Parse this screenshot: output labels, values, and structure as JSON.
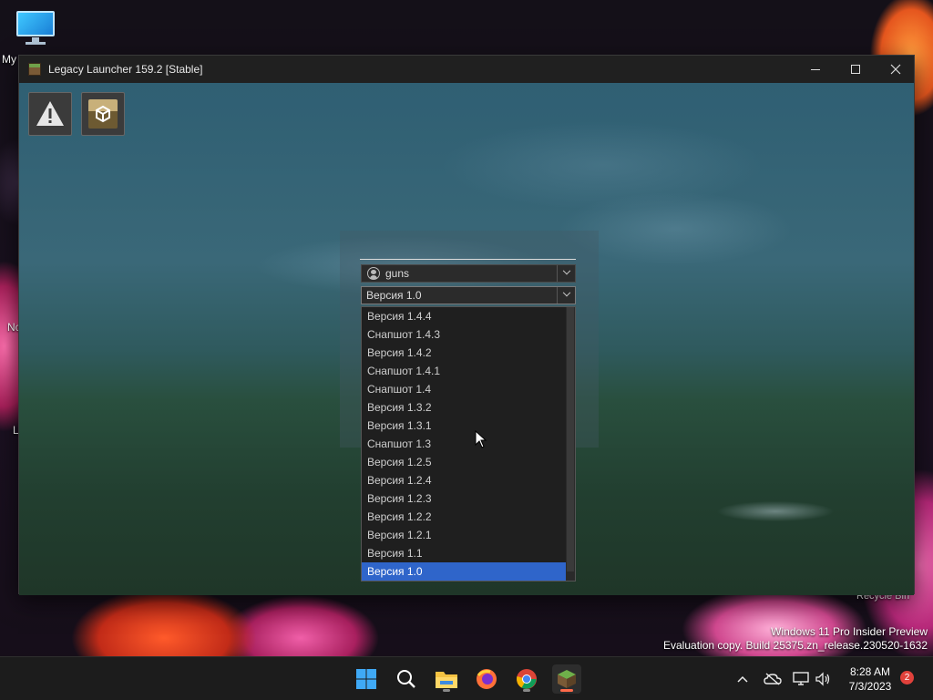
{
  "desktop": {
    "icons": [
      {
        "label": "My"
      },
      {
        "label": "Nc"
      },
      {
        "label": "L"
      }
    ],
    "recycle_bin_label": "Recycle Bin",
    "watermark_line1": "Windows 11 Pro Insider Preview",
    "watermark_line2": "Evaluation copy. Build 25375.zn_release.230520-1632"
  },
  "window": {
    "title": "Legacy Launcher 159.2 [Stable]",
    "buttons": {
      "minimize": "minimize",
      "maximize": "maximize",
      "close": "close"
    }
  },
  "launcher": {
    "account": {
      "username": "guns"
    },
    "version_selector": {
      "selected": "Версия 1.0",
      "options": [
        "Версия 1.4.4",
        "Снапшот 1.4.3",
        "Версия 1.4.2",
        "Снапшот 1.4.1",
        "Снапшот 1.4",
        "Версия 1.3.2",
        "Версия 1.3.1",
        "Снапшот 1.3",
        "Версия 1.2.5",
        "Версия 1.2.4",
        "Версия 1.2.3",
        "Версия 1.2.2",
        "Версия 1.2.1",
        "Версия 1.1",
        "Версия 1.0"
      ],
      "selected_index": 14
    },
    "toolbar": [
      "warning-icon",
      "package-icon"
    ]
  },
  "taskbar": {
    "apps": [
      "windows-start-icon",
      "search-icon",
      "file-explorer-icon",
      "firefox-icon",
      "chrome-icon",
      "legacy-launcher-icon"
    ],
    "active_app": "legacy-launcher-icon",
    "tray_icons": [
      "chevron-up-icon",
      "cloud-offline-icon",
      "network-icon",
      "volume-icon"
    ],
    "time": "8:28 AM",
    "date": "7/3/2023",
    "notification_count": "2"
  },
  "colors": {
    "selection": "#2f65ca",
    "taskbar": "#1c1c1c",
    "window_title_bar": "#202020"
  }
}
